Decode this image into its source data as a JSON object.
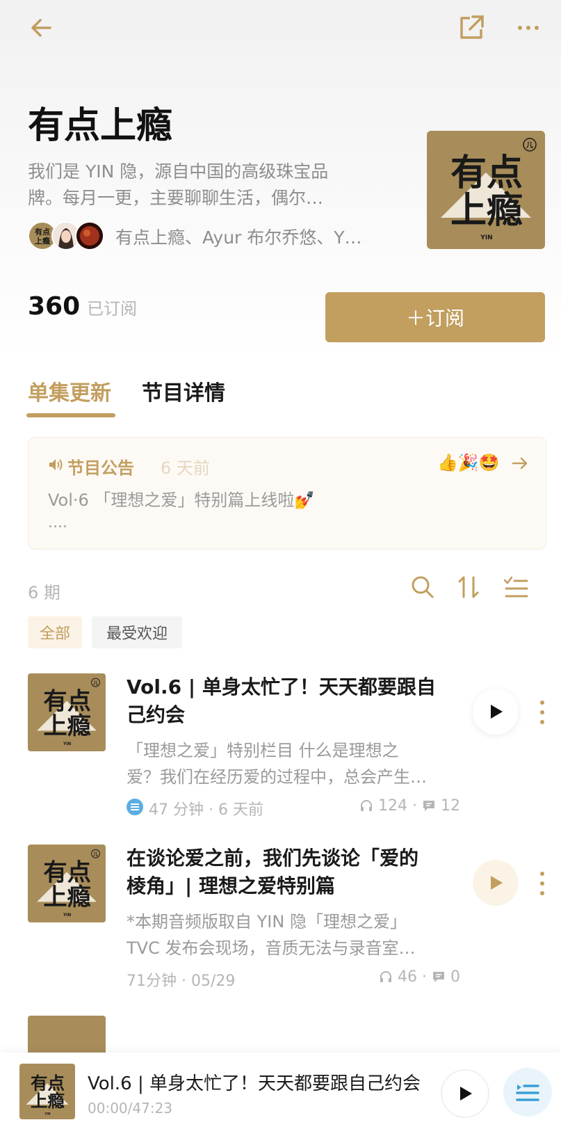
{
  "colors": {
    "accent": "#c29e5f",
    "cover_bg": "#a88d5a",
    "muted": "#9a9a9a"
  },
  "podcast": {
    "title": "有点上瘾",
    "description_line1": "我们是 YIN 隐，源自中国的高级珠宝品",
    "description_line2": "牌。每月一更，主要聊聊生活，偶尔…",
    "hosts": "有点上瘾、Ayur 布尔乔悠、Y…",
    "subscriber_count": "360",
    "subscriber_label": "已订阅",
    "subscribe_label": "＋订阅"
  },
  "cover": {
    "line1": "有点",
    "line2": "上瘾",
    "brand": "YIN",
    "corner": "儿"
  },
  "tabs": [
    {
      "label": "单集更新",
      "active": true
    },
    {
      "label": "节目详情",
      "active": false
    }
  ],
  "notice": {
    "title": "节目公告",
    "time": "6 天前",
    "emojis": "👍🎉🤩",
    "body": "Vol·6 「理想之爱」特别篇上线啦💅",
    "more": "...."
  },
  "episode_count": "6 期",
  "filters": [
    {
      "label": "全部",
      "active": true
    },
    {
      "label": "最受欢迎",
      "active": false
    }
  ],
  "episodes": [
    {
      "title_line1": "Vol.6 | 单身太忙了！天天都要跟自",
      "title_line2": "己约会",
      "desc_line1": "「理想之爱」特别栏目 什么是理想之",
      "desc_line2": "爱？我们在经历爱的过程中，总会产生…",
      "duration": "47 分钟 · 6 天前",
      "plays": "124",
      "comments": "12",
      "icon": "list-icon"
    },
    {
      "title_line1": "在谈论爱之前，我们先谈论「爱的",
      "title_line2": "棱角」| 理想之爱特别篇",
      "desc_line1": "*本期音频版取自 YIN 隐「理想之爱」",
      "desc_line2": "TVC 发布会现场，音质无法与录音室…",
      "duration": "71分钟 · 05/29",
      "plays": "46",
      "comments": "0"
    }
  ],
  "player": {
    "title": "Vol.6 | 单身太忙了！天天都要跟自己约会",
    "time": "00:00/47:23"
  }
}
